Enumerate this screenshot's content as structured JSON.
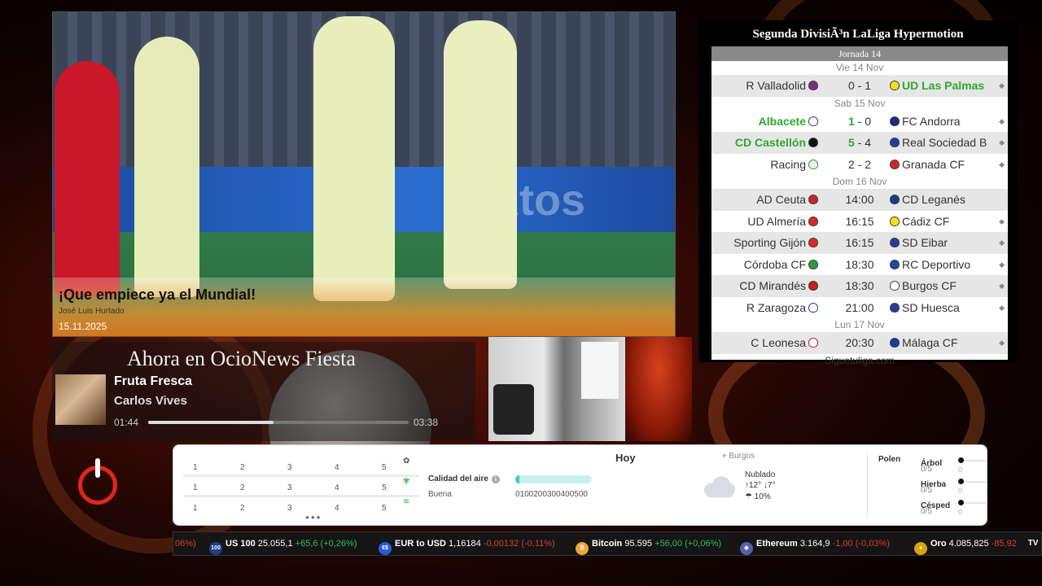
{
  "news": {
    "title": "¡Que empiece ya el Mundial!",
    "author": "José Luis Hurtado",
    "date": "15.11.2025",
    "board_text": "Atos"
  },
  "league": {
    "title": "Segunda DivisiÃ³n LaLiga Hypermotion",
    "jornada": "Jornada 14",
    "footer": "Siguetuliga.com",
    "days": {
      "vie": "Vie 14 Nov",
      "sab": "Sab 15 Nov",
      "dom": "Dom 16 Nov",
      "lun": "Lun 17 Nov"
    },
    "matches": [
      {
        "home": "R Valladolid",
        "score": "0 - 1",
        "away": "UD Las Palmas",
        "home_color": "#7b2b8a",
        "away_color": "#f3e21a"
      },
      {
        "home": "Albacete",
        "score": "1 - 0",
        "away": "FC Andorra",
        "home_color": "#ffffff",
        "away_color": "#1d2c7a"
      },
      {
        "home": "CD Castellón",
        "score": "5 - 4",
        "away": "Real Sociedad B",
        "home_color": "#111111",
        "away_color": "#1e3f9a"
      },
      {
        "home": "Racing",
        "score": "2 - 2",
        "away": "Granada CF",
        "home_color": "#e9f5e9",
        "away_color": "#d2262c"
      },
      {
        "home": "AD Ceuta",
        "score": "14:00",
        "away": "CD Leganés",
        "home_color": "#c9252b",
        "away_color": "#1a3a8a"
      },
      {
        "home": "UD Almería",
        "score": "16:15",
        "away": "Cádiz CF",
        "home_color": "#d02a2a",
        "away_color": "#f5e01a"
      },
      {
        "home": "Sporting Gijón",
        "score": "16:15",
        "away": "SD Eibar",
        "home_color": "#d52b2b",
        "away_color": "#2a3a9a"
      },
      {
        "home": "Córdoba CF",
        "score": "18:30",
        "away": "RC Deportivo",
        "home_color": "#2a9a3a",
        "away_color": "#1a4aa8"
      },
      {
        "home": "CD Mirandés",
        "score": "18:30",
        "away": "Burgos CF",
        "home_color": "#c81e1e",
        "away_color": "#ffffff"
      },
      {
        "home": "R Zaragoza",
        "score": "21:00",
        "away": "SD Huesca",
        "home_color": "#2a3aa0",
        "away_color": "#2a3aa0"
      },
      {
        "home": "C Leonesa",
        "score": "20:30",
        "away": "Málaga CF",
        "home_color": "#ffffff",
        "away_color": "#1a3aa0"
      }
    ]
  },
  "now_playing": {
    "header": "Ahora en OcioNews Fiesta",
    "song": "Fruta Fresca",
    "artist": "Carlos Vives",
    "elapsed": "01:44",
    "duration": "03:38",
    "progress": 0.48
  },
  "weather": {
    "grid_numbers": [
      "1",
      "2",
      "3",
      "4",
      "5"
    ],
    "air_label": "Calidad del aire",
    "air_quality": "Buena",
    "air_scale": "0100200300400500",
    "air_level": 0.05,
    "today": "Hoy",
    "location": "Burgos",
    "state": "Nublado",
    "temps": "↑12° ↓7°",
    "rain": "10%",
    "polen_label": "Polen",
    "polen": [
      {
        "name": "Árbol",
        "score": "0/5",
        "zero": "0"
      },
      {
        "name": "Hierba",
        "score": "0/5",
        "zero": "0"
      },
      {
        "name": "Césped",
        "score": "0/5",
        "zero": "0"
      }
    ]
  },
  "ticker": {
    "lead_fragment": "06%)",
    "items": [
      {
        "icon": "100",
        "name": "US 100",
        "value": "25.055,1",
        "change": "+65,6 (+0,26%)",
        "dir": "up",
        "color": "#1f3c88"
      },
      {
        "icon": "€$",
        "name": "EUR to USD",
        "value": "1,16184",
        "change": "-0,00132 (-0,11%)",
        "dir": "down",
        "color": "#2a5bd7"
      },
      {
        "icon": "₿",
        "name": "Bitcoin",
        "value": "95.595",
        "change": "+56,00 (+0,06%)",
        "dir": "up",
        "color": "#f2a33a"
      },
      {
        "icon": "◆",
        "name": "Ethereum",
        "value": "3.164,9",
        "change": "-1,00 (-0,03%)",
        "dir": "down",
        "color": "#5360a8"
      },
      {
        "icon": "●",
        "name": "Oro",
        "value": "4.085,825",
        "change": "-85,92",
        "dir": "down",
        "color": "#d9a30e"
      }
    ],
    "tv_label": "TV"
  }
}
